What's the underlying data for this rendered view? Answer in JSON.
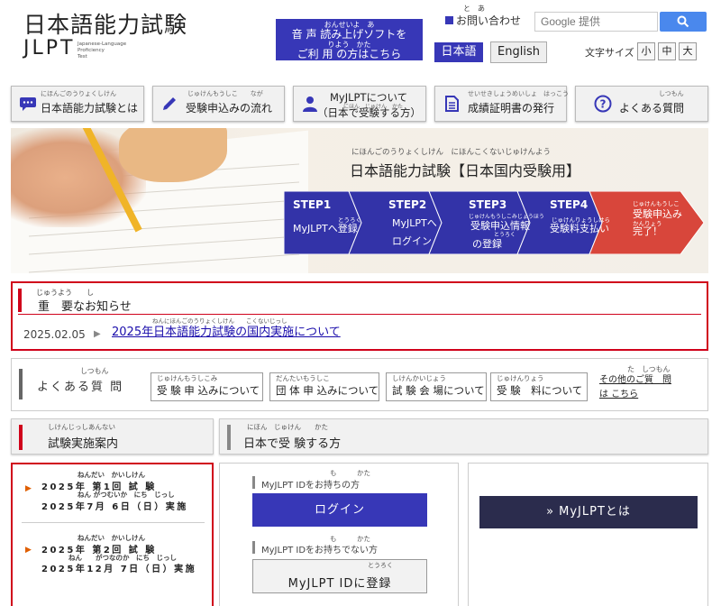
{
  "header": {
    "logo_title": "日本語能力試験",
    "logo_jlpt": "JLPT",
    "logo_sub": [
      "Japanese-Language",
      "Proficiency",
      "Test"
    ],
    "voice": {
      "ruby1": "おんせいよ　あ",
      "line1": "音 声 読み上げソフトを",
      "ruby2": "りよう　かた",
      "line2": "ご利 用 の方はこちら"
    },
    "contact": {
      "ruby": "と　あ",
      "label": "お問い合わせ"
    },
    "search": {
      "placeholder": "Google 提供"
    },
    "lang_ja": "日本語",
    "lang_en": "English",
    "font_size": {
      "label": "文字サイズ",
      "small": "小",
      "medium": "中",
      "large": "大"
    }
  },
  "nav": {
    "about": {
      "ruby": "にほんごのうりょくしけん",
      "label": "日本語能力試験とは"
    },
    "flow": {
      "ruby": "じゅけんもうしこ　　なが",
      "label": "受験申込みの流れ"
    },
    "myjlpt": {
      "line1": "MyJLPTについて",
      "ruby": "にほん　じゅけん　かた",
      "line2": "（日本で受験する方）"
    },
    "cert": {
      "ruby": "せいせきしょうめいしょ　はっこう",
      "label": "成績証明書の発行"
    },
    "faq": {
      "ruby": "しつもん",
      "label": "よくある質問"
    }
  },
  "hero": {
    "ruby": "にほんごのうりょくしけん　にほんこくないじゅけんよう",
    "title": "日本語能力試験【日本国内受験用】",
    "steps": [
      {
        "name": "STEP1",
        "ruby": "とうろく",
        "l1": "MyJLPTへ登録",
        "l2": ""
      },
      {
        "name": "STEP2",
        "ruby": "",
        "l1": "MyJLPTへ",
        "l2": "ログイン"
      },
      {
        "name": "STEP3",
        "ruby": "じゅけんもうしこみじょうほう",
        "l1": "受験申込情報",
        "l2": "の登録",
        "ruby2": "とうろく"
      },
      {
        "name": "STEP4",
        "ruby": "じゅけんりょうしはら",
        "l1": "受験料支払い",
        "l2": ""
      },
      {
        "name": "",
        "ruby": "じゅけんもうしこ",
        "l1": "受験申込み",
        "l2": "完了！",
        "ruby2": "かんりょう"
      }
    ]
  },
  "notice": {
    "ruby": "じゅうよう　　し",
    "title": "重　要なお知らせ",
    "items": [
      {
        "date": "2025.02.05",
        "ruby": "ねんにほんごのうりょくしけん　　こくないじっし",
        "text": "2025年日本語能力試験の国内実施について"
      }
    ]
  },
  "faq": {
    "ruby": "しつもん",
    "title": "よくある質 問",
    "buttons": [
      {
        "ruby": "じゅけんもうしこみ",
        "label": "受 験 申 込みについて"
      },
      {
        "ruby": "だんたいもうしこ",
        "label": "団 体 申 込みについて"
      },
      {
        "ruby": "しけんかいじょう",
        "label": "試 験 会 場について"
      },
      {
        "ruby": "じゅけんりょう",
        "label": "受 験　料について"
      }
    ],
    "other_ruby": "た　しつもん",
    "other": "その他のご質　問は こちら"
  },
  "sections": {
    "schedule": {
      "ruby": "しけんじっしあんない",
      "label": "試験実施案内"
    },
    "domestic": {
      "ruby": "にほん　じゅけん　　かた",
      "label": "日本で受 験する方"
    }
  },
  "schedule": [
    {
      "ruby1": "ねんだい　かいしけん",
      "line1": "2025年 第1回 試 験",
      "ruby2": "ねん がつむいか　にち　じっし",
      "line2": "2025年7月 6日（日）実施"
    },
    {
      "ruby1": "ねんだい　かいしけん",
      "line1": "2025年 第2回 試 験",
      "ruby2": "ねん　　がつなのか　にち　じっし",
      "line2": "2025年12月 7日（日）実施"
    }
  ],
  "login_panel": {
    "has_id_ruby": "も　　　かた",
    "has_id": "MyJLPT IDをお持ちの方",
    "login": "ログイン",
    "no_id_ruby": "も　　　かた",
    "no_id": "MyJLPT IDをお持ちでない方",
    "register_ruby": "とうろく",
    "register": "MyJLPT IDに登録"
  },
  "my_panel": {
    "button": "» MyJLPTとは"
  },
  "colors": {
    "primary": "#3737b7",
    "accent": "#d0021b",
    "dark": "#2b2c4d",
    "step": "#3333a8"
  }
}
